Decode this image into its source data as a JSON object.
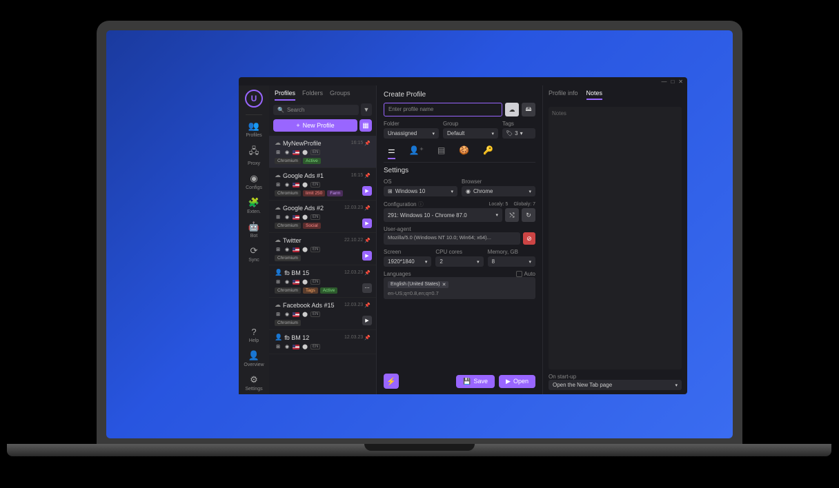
{
  "rail": {
    "profiles": "Profiles",
    "proxy": "Proxy",
    "configs": "Configs",
    "exten": "Exten.",
    "bot": "Bot",
    "sync": "Sync",
    "help": "Help",
    "overview": "Overview",
    "settings": "Settings"
  },
  "tabs": {
    "profiles": "Profiles",
    "folders": "Folders",
    "groups": "Groups"
  },
  "search": {
    "placeholder": "Search"
  },
  "newProfileBtn": "New Profile",
  "profiles": [
    {
      "name": "MyNewProfile",
      "date": "16:15",
      "lang": "EN",
      "engine": "Chromium",
      "tags": [
        "Active"
      ],
      "tagColors": [
        "green"
      ],
      "play": "none",
      "selected": true
    },
    {
      "name": "Google Ads #1",
      "date": "16:15",
      "lang": "EN",
      "engine": "Chromium",
      "tags": [
        "limit 250",
        "Farm"
      ],
      "tagColors": [
        "red",
        "purple"
      ],
      "play": "purple"
    },
    {
      "name": "Google Ads #2",
      "date": "12.03.23",
      "lang": "EN",
      "engine": "Chromium",
      "tags": [
        "Social"
      ],
      "tagColors": [
        "red"
      ],
      "play": "purple"
    },
    {
      "name": "Twitter",
      "date": "22.10.22",
      "lang": "EN",
      "engine": "Chromium",
      "tags": [],
      "tagColors": [],
      "play": "purple"
    },
    {
      "name": "fb BM 15",
      "date": "12.03.23",
      "lang": "EN",
      "engine": "Chromium",
      "tags": [
        "Tags",
        "Active"
      ],
      "tagColors": [
        "orange",
        "green"
      ],
      "play": "dots",
      "fbIcon": true
    },
    {
      "name": "Facebook Ads #15",
      "date": "12.03.23",
      "lang": "EN",
      "engine": "Chromium",
      "tags": [],
      "tagColors": [],
      "play": "grey"
    },
    {
      "name": "fb BM 12",
      "date": "12.03.23",
      "lang": "EN",
      "engine": "",
      "tags": [],
      "tagColors": [],
      "play": "none",
      "fbIcon": true
    }
  ],
  "create": {
    "title": "Create Profile",
    "namePlaceholder": "Enter profile name",
    "folderLabel": "Folder",
    "folderValue": "Unassigned",
    "groupLabel": "Group",
    "groupValue": "Default",
    "tagsLabel": "Tags",
    "tagsCount": "3",
    "settingsTitle": "Settings",
    "osLabel": "OS",
    "osValue": "Windows 10",
    "browserLabel": "Browser",
    "browserValue": "Chrome",
    "configLabel": "Configuration",
    "localy": "Localy: 5",
    "globaly": "Globaly: 7",
    "configValue": "291: Windows 10 - Chrome 87.0",
    "uaLabel": "User-agent",
    "uaValue": "Mozilla/5.0 (Windows NT 10.0; Win64; x64)...",
    "screenLabel": "Screen",
    "screenValue": "1920*1840",
    "cpuLabel": "CPU cores",
    "cpuValue": "2",
    "memLabel": "Memory, GB",
    "memValue": "8",
    "langLabel": "Languages",
    "autoLabel": "Auto",
    "langChip": "English (United States)",
    "langString": "en-US;q=0.8,en;q=0.7",
    "saveBtn": "Save",
    "openBtn": "Open"
  },
  "right": {
    "profileInfo": "Profile info",
    "notes": "Notes",
    "notesPlaceholder": "Notes",
    "startupLabel": "On start-up",
    "startupValue": "Open the New Tab page"
  }
}
